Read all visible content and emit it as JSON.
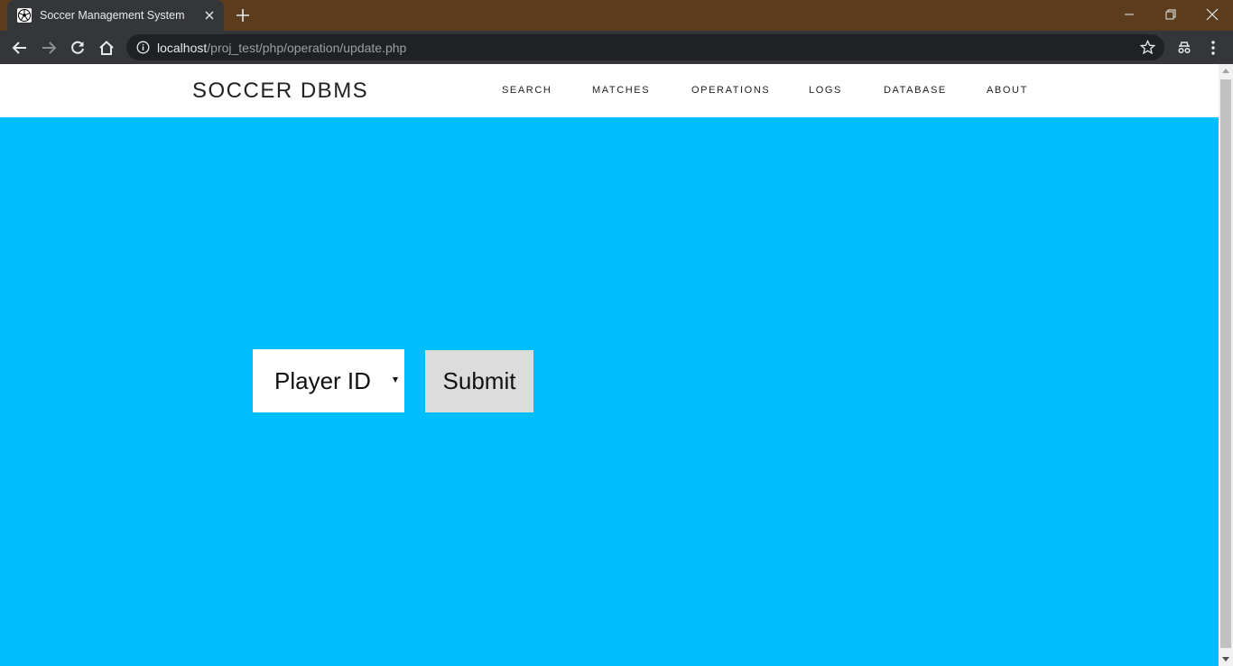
{
  "browser": {
    "tab_title": "Soccer Management System",
    "url_host": "localhost",
    "url_path": "/proj_test/php/operation/update.php"
  },
  "navbar": {
    "brand": "SOCCER DBMS",
    "links": [
      "SEARCH",
      "MATCHES",
      "OPERATIONS",
      "LOGS",
      "DATABASE",
      "ABOUT"
    ]
  },
  "form": {
    "select_value": "Player ID",
    "submit_label": "Submit"
  },
  "colors": {
    "page_background": "#00bfff",
    "titlebar": "#5b3d1d",
    "toolbar": "#35363a"
  }
}
